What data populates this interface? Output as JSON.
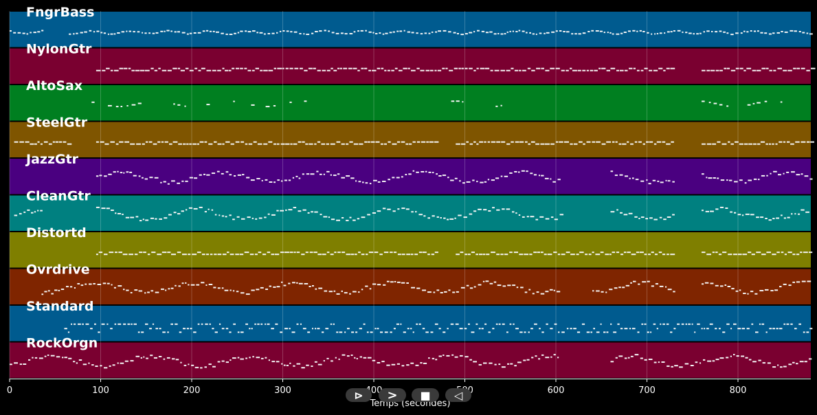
{
  "chart_data": {
    "type": "heatmap",
    "xlabel": "Temps (secondes)",
    "xlim": [
      0,
      880
    ],
    "x_ticks": [
      0,
      100,
      200,
      300,
      400,
      500,
      600,
      700,
      800
    ],
    "grid": true,
    "tracks": [
      {
        "name": "FngrBass",
        "color": "#005b8f",
        "active": [
          [
            0,
            35
          ],
          [
            65,
            880
          ]
        ],
        "style": "line"
      },
      {
        "name": "NylonGtr",
        "color": "#7a0030",
        "active": [
          [
            95,
            730
          ],
          [
            760,
            880
          ]
        ],
        "style": "dense"
      },
      {
        "name": "AltoSax",
        "color": "#007f20",
        "active": [
          [
            35,
            45
          ],
          [
            90,
            335
          ],
          [
            485,
            540
          ],
          [
            760,
            855
          ]
        ],
        "style": "sparse"
      },
      {
        "name": "SteelGtr",
        "color": "#7f5500",
        "active": [
          [
            5,
            65
          ],
          [
            95,
            470
          ],
          [
            490,
            730
          ],
          [
            760,
            880
          ]
        ],
        "style": "dense"
      },
      {
        "name": "JazzGtr",
        "color": "#4a0080",
        "active": [
          [
            95,
            605
          ],
          [
            660,
            730
          ],
          [
            760,
            880
          ]
        ],
        "style": "melody"
      },
      {
        "name": "CleanGtr",
        "color": "#008080",
        "active": [
          [
            5,
            35
          ],
          [
            95,
            605
          ],
          [
            660,
            730
          ],
          [
            760,
            880
          ]
        ],
        "style": "melody"
      },
      {
        "name": "Distortd",
        "color": "#7f7f00",
        "active": [
          [
            95,
            470
          ],
          [
            490,
            730
          ],
          [
            760,
            880
          ]
        ],
        "style": "dense"
      },
      {
        "name": "Ovrdrive",
        "color": "#7f2500",
        "active": [
          [
            35,
            605
          ],
          [
            640,
            730
          ],
          [
            760,
            880
          ]
        ],
        "style": "melody"
      },
      {
        "name": "Standard",
        "color": "#005b8f",
        "active": [
          [
            60,
            880
          ]
        ],
        "style": "drums"
      },
      {
        "name": "RockOrgn",
        "color": "#7a0030",
        "active": [
          [
            0,
            605
          ],
          [
            660,
            880
          ]
        ],
        "style": "melody"
      }
    ]
  },
  "controls": {
    "play_label": "⊳",
    "forward_label": ">",
    "stop_label": "■",
    "back_label": "◁"
  }
}
